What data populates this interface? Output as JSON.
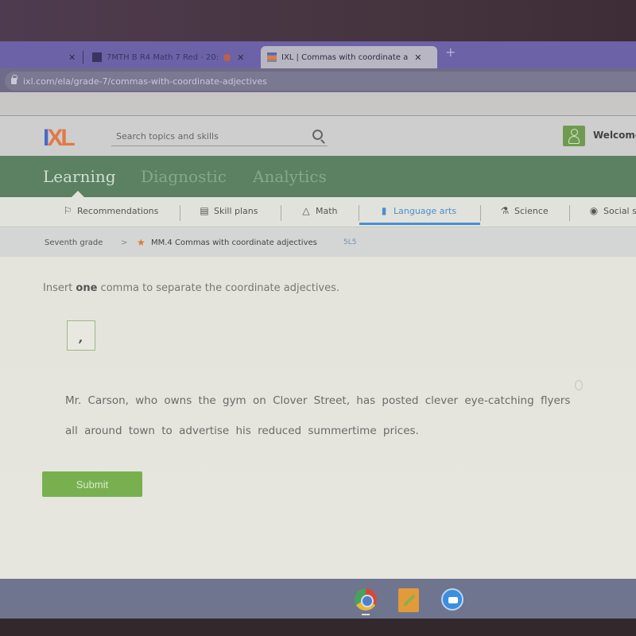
{
  "browser": {
    "tabs": [
      {
        "label": "",
        "active": false
      },
      {
        "label": "7MTH B R4 Math 7 Red - 20:",
        "active": false
      },
      {
        "label": "IXL | Commas with coordinate a",
        "active": true
      }
    ],
    "new_tab": "+",
    "close_glyph": "✕",
    "url": "ixl.com/ela/grade-7/commas-with-coordinate-adjectives"
  },
  "header": {
    "logo_i": "I",
    "logo_xl": "XL",
    "search_placeholder": "Search topics and skills",
    "welcome": "Welcome"
  },
  "main_nav": [
    "Learning",
    "Diagnostic",
    "Analytics"
  ],
  "sub_nav": [
    {
      "label": "Recommendations",
      "icon": "⚐"
    },
    {
      "label": "Skill plans",
      "icon": "▤"
    },
    {
      "label": "Math",
      "icon": "△"
    },
    {
      "label": "Language arts",
      "icon": "▮",
      "active": true
    },
    {
      "label": "Science",
      "icon": "⚗"
    },
    {
      "label": "Social s",
      "icon": "◉"
    }
  ],
  "breadcrumb": {
    "grade": "Seventh grade",
    "separator": ">",
    "star": "★",
    "skill": "MM.4 Commas with coordinate adjectives",
    "code": "5L5"
  },
  "question": {
    "instruction_pre": "Insert ",
    "instruction_bold": "one",
    "instruction_post": " comma to separate the coordinate adjectives.",
    "draggable_comma": ",",
    "sentence": "Mr. Carson, who owns the gym on Clover Street, has posted clever eye-catching flyers all around town to advertise his reduced summertime prices.",
    "submit_label": "Submit"
  },
  "shelf": {
    "apps": [
      "chrome-icon",
      "notes-pencil-icon",
      "zoom-video-icon"
    ]
  }
}
